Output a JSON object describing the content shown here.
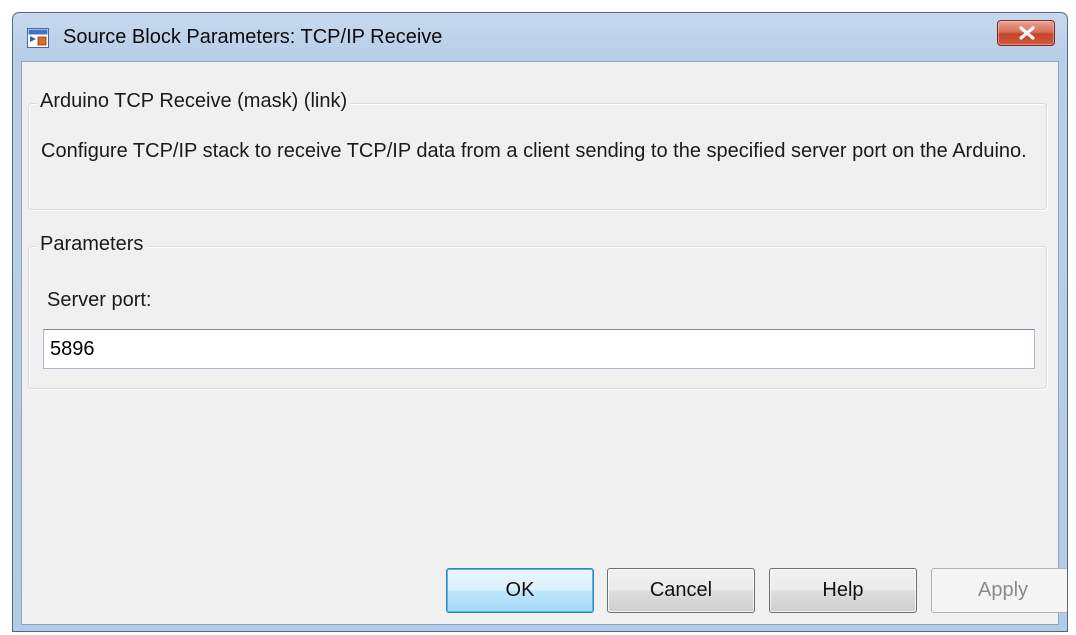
{
  "window": {
    "title": "Source Block Parameters: TCP/IP Receive",
    "accent_color": "#b9cfe8",
    "close_button_color": "#c2442c"
  },
  "description_group": {
    "legend": "Arduino TCP Receive (mask) (link)",
    "text": "Configure TCP/IP stack to receive TCP/IP data from a client sending to the specified server port on the Arduino."
  },
  "parameters_group": {
    "legend": "Parameters",
    "server_port_label": "Server port:",
    "server_port_value": "5896"
  },
  "buttons": {
    "ok": "OK",
    "cancel": "Cancel",
    "help": "Help",
    "apply": "Apply"
  },
  "icons": {
    "title_icon": "simulink-block-icon",
    "close_icon": "close-icon"
  }
}
